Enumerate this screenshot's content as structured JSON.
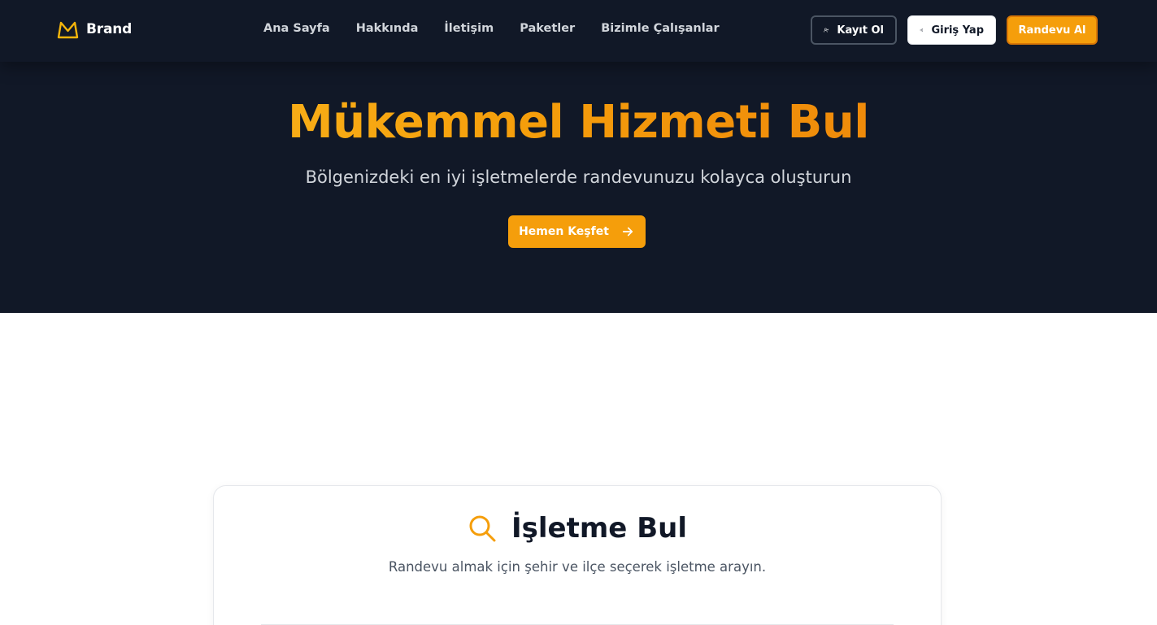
{
  "nav": {
    "brand": "Brand",
    "links": [
      "Ana Sayfa",
      "Hakkında",
      "İletişim",
      "Paketler",
      "Bizimle Çalışanlar"
    ],
    "register_label": "Kayıt Ol",
    "login_label": "Giriş Yap",
    "appointment_label": "Randevu Al"
  },
  "hero": {
    "title": "Mükemmel Hizmeti Bul",
    "subtitle": "Bölgenizdeki en iyi işletmelerde randevunuzu kolayca oluşturun",
    "cta_label": "Hemen Keşfet"
  },
  "search_card": {
    "title": "İşletme Bul",
    "subtitle": "Randevu almak için şehir ve ilçe seçerek işletme arayın."
  },
  "colors": {
    "accent": "#f59e0b",
    "dark_bg": "#111827",
    "nav_text": "#d1d5db"
  },
  "icons": {
    "brand": "crown-icon",
    "register": "user-plus-icon",
    "login": "login-icon",
    "cta": "arrow-right-icon",
    "search": "search-icon"
  }
}
